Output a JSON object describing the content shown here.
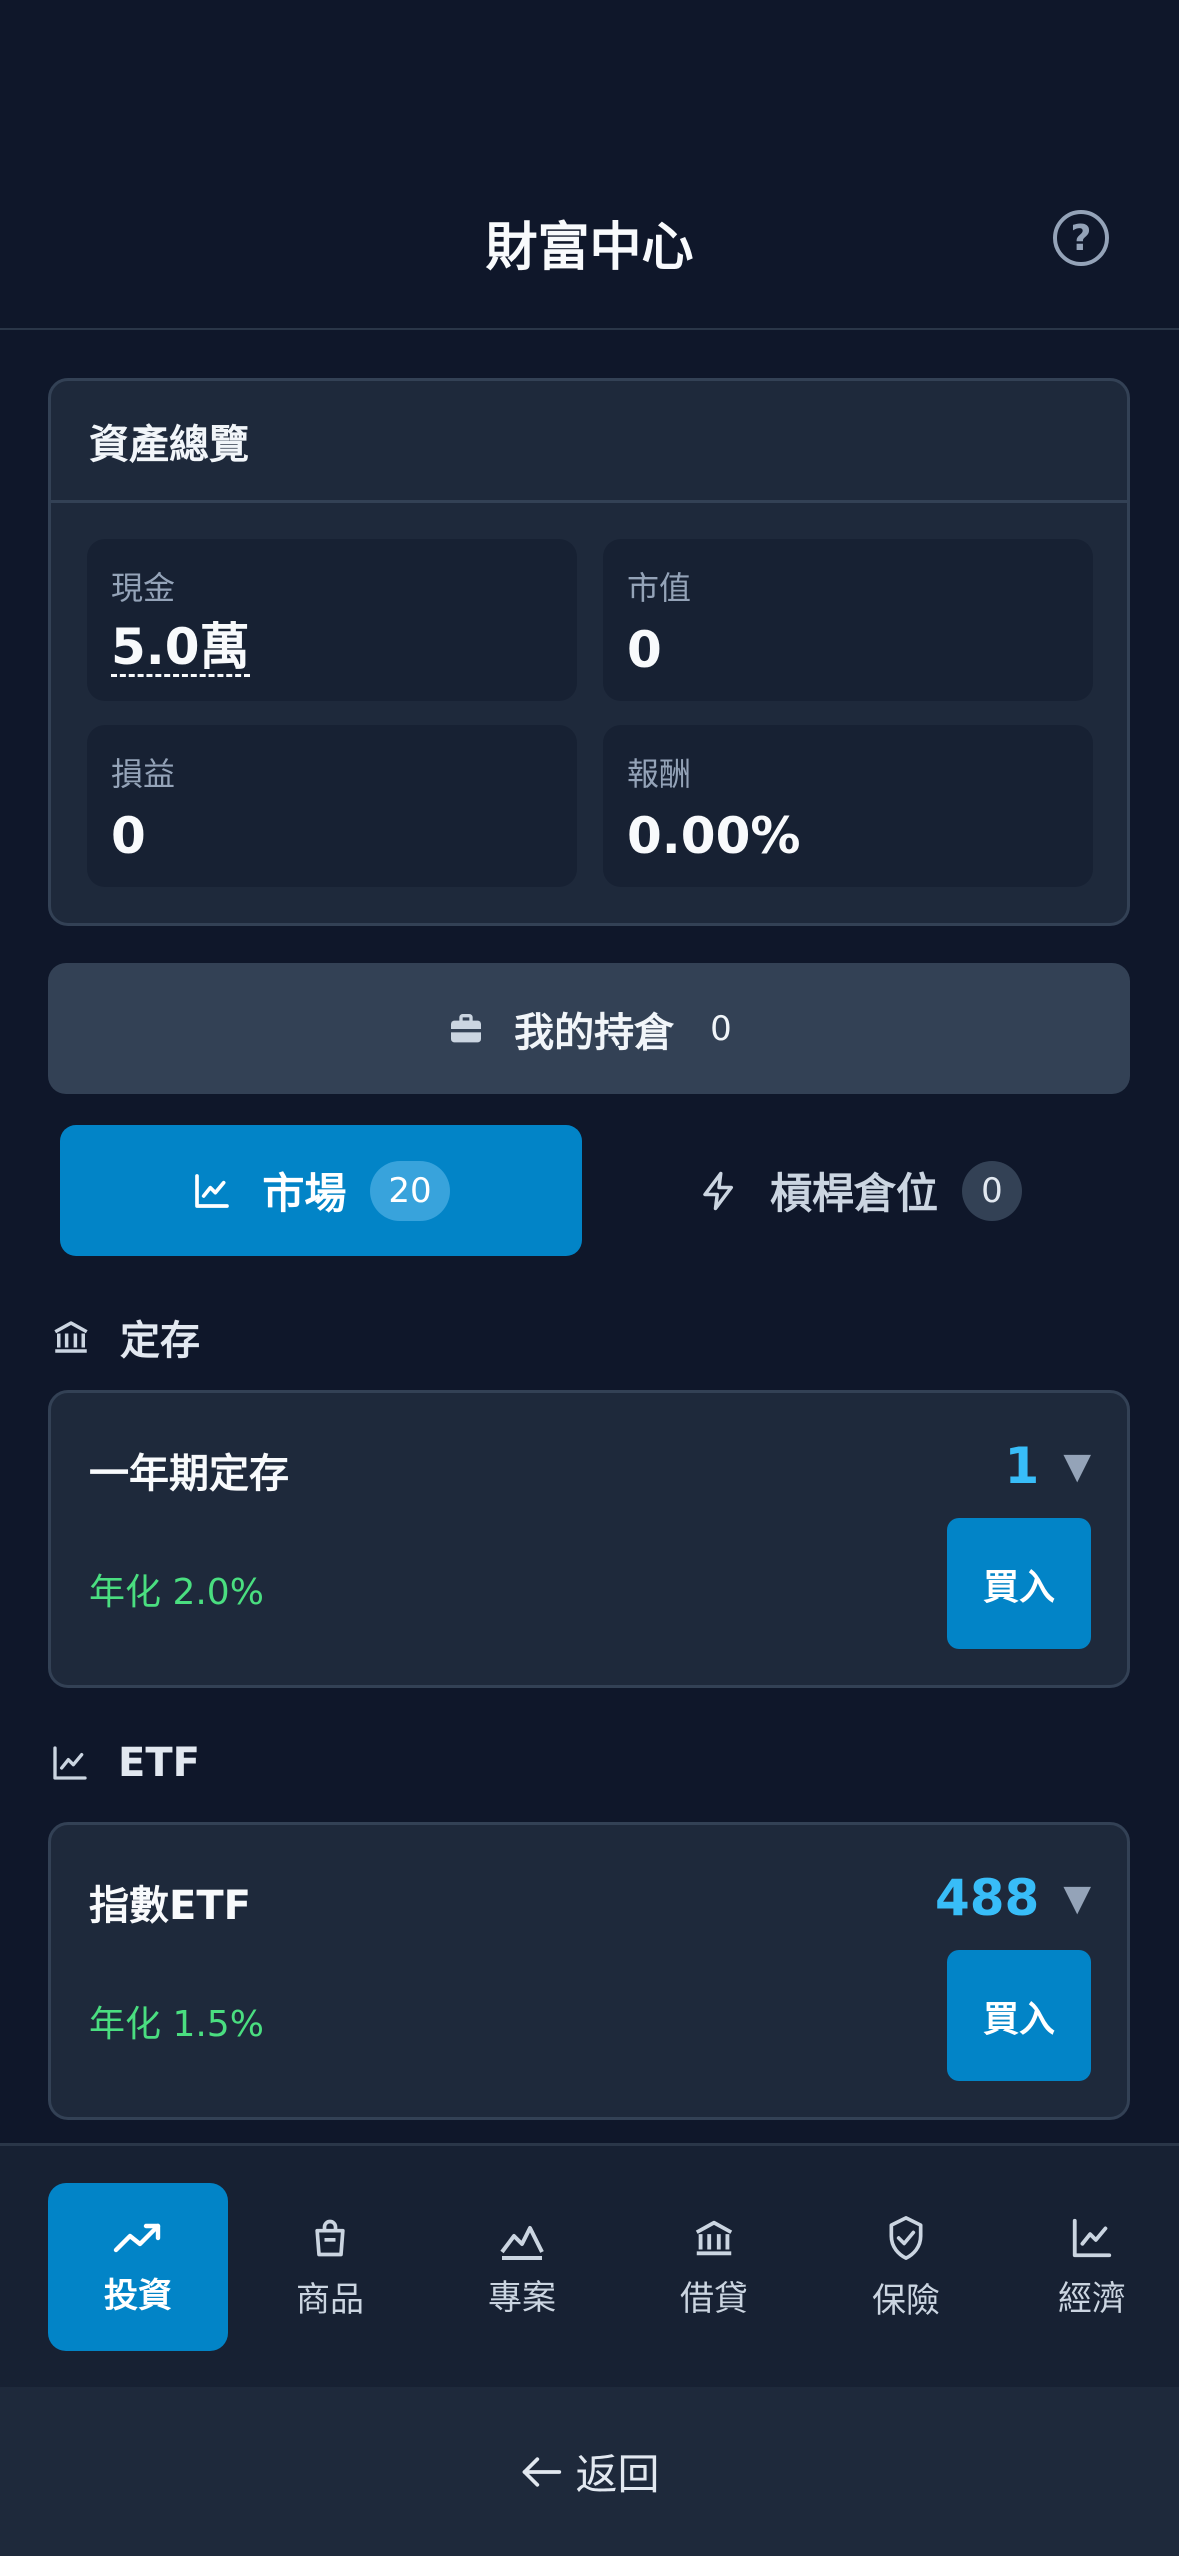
{
  "header": {
    "title": "財富中心",
    "help_icon": "?"
  },
  "overview": {
    "title": "資產總覽",
    "stats": [
      {
        "label": "現金",
        "value": "5.0萬"
      },
      {
        "label": "市值",
        "value": "0"
      },
      {
        "label": "損益",
        "value": "0"
      },
      {
        "label": "報酬",
        "value": "0.00%"
      }
    ]
  },
  "holdings": {
    "label": "我的持倉",
    "count": "0",
    "icon": "briefcase-icon"
  },
  "tabs": [
    {
      "label": "市場",
      "badge": "20",
      "icon": "chart-line-icon",
      "active": true
    },
    {
      "label": "槓桿倉位",
      "badge": "0",
      "icon": "lightning-icon",
      "active": false
    }
  ],
  "sections": [
    {
      "title": "定存",
      "icon": "bank-icon",
      "card": {
        "name": "一年期定存",
        "qty": "1",
        "rate": "年化 2.0%",
        "buy_label": "買入"
      }
    },
    {
      "title": "ETF",
      "icon": "chart-line-icon",
      "card": {
        "name": "指數ETF",
        "qty": "488",
        "rate": "年化 1.5%",
        "buy_label": "買入"
      }
    }
  ],
  "nav": [
    {
      "label": "投資",
      "icon": "trending-up-icon",
      "active": true
    },
    {
      "label": "商品",
      "icon": "shopping-bag-icon"
    },
    {
      "label": "專案",
      "icon": "area-chart-icon"
    },
    {
      "label": "借貸",
      "icon": "bank-icon"
    },
    {
      "label": "保險",
      "icon": "shield-check-icon"
    },
    {
      "label": "經濟",
      "icon": "chart-line-icon"
    }
  ],
  "back": {
    "label": "返回",
    "icon": "arrow-left-icon"
  },
  "colors": {
    "accent": "#0284c7",
    "positive": "#4ade80",
    "qty": "#38bdf8",
    "background": "#0f172a",
    "card": "#1e293b"
  }
}
